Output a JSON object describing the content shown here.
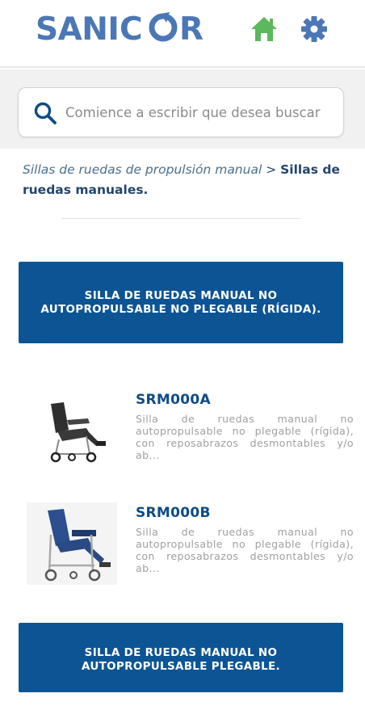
{
  "header": {
    "logo_text": "SANICOR",
    "home_icon": "home-icon",
    "settings_icon": "gear-icon",
    "accent_color": "#4b77b6",
    "home_color": "#5cb85c"
  },
  "search": {
    "placeholder": "Comience a escribir que desea buscar",
    "value": "",
    "icon": "search-icon"
  },
  "breadcrumb": {
    "parent": "Sillas de ruedas de propulsión manual",
    "separator": ">",
    "current": "Sillas de ruedas manuales."
  },
  "categories": [
    {
      "label": "SILLA DE RUEDAS MANUAL NO AUTOPROPULSABLE NO PLEGABLE (RÍGIDA)."
    },
    {
      "label": "SILLA DE RUEDAS MANUAL NO AUTOPROPULSABLE PLEGABLE."
    }
  ],
  "products": [
    {
      "code": "SRM000A",
      "description": "Silla de ruedas manual no autopropulsable no plegable (rígida), con reposabrazos desmontables y/o ab..."
    },
    {
      "code": "SRM000B",
      "description": "Silla de ruedas manual no autopropulsable no plegable (rígida), con reposabrazos desmontables y/o ab..."
    }
  ],
  "colors": {
    "banner": "#0d5494",
    "product_code": "#0d4c87",
    "description": "#a0a0a0"
  }
}
